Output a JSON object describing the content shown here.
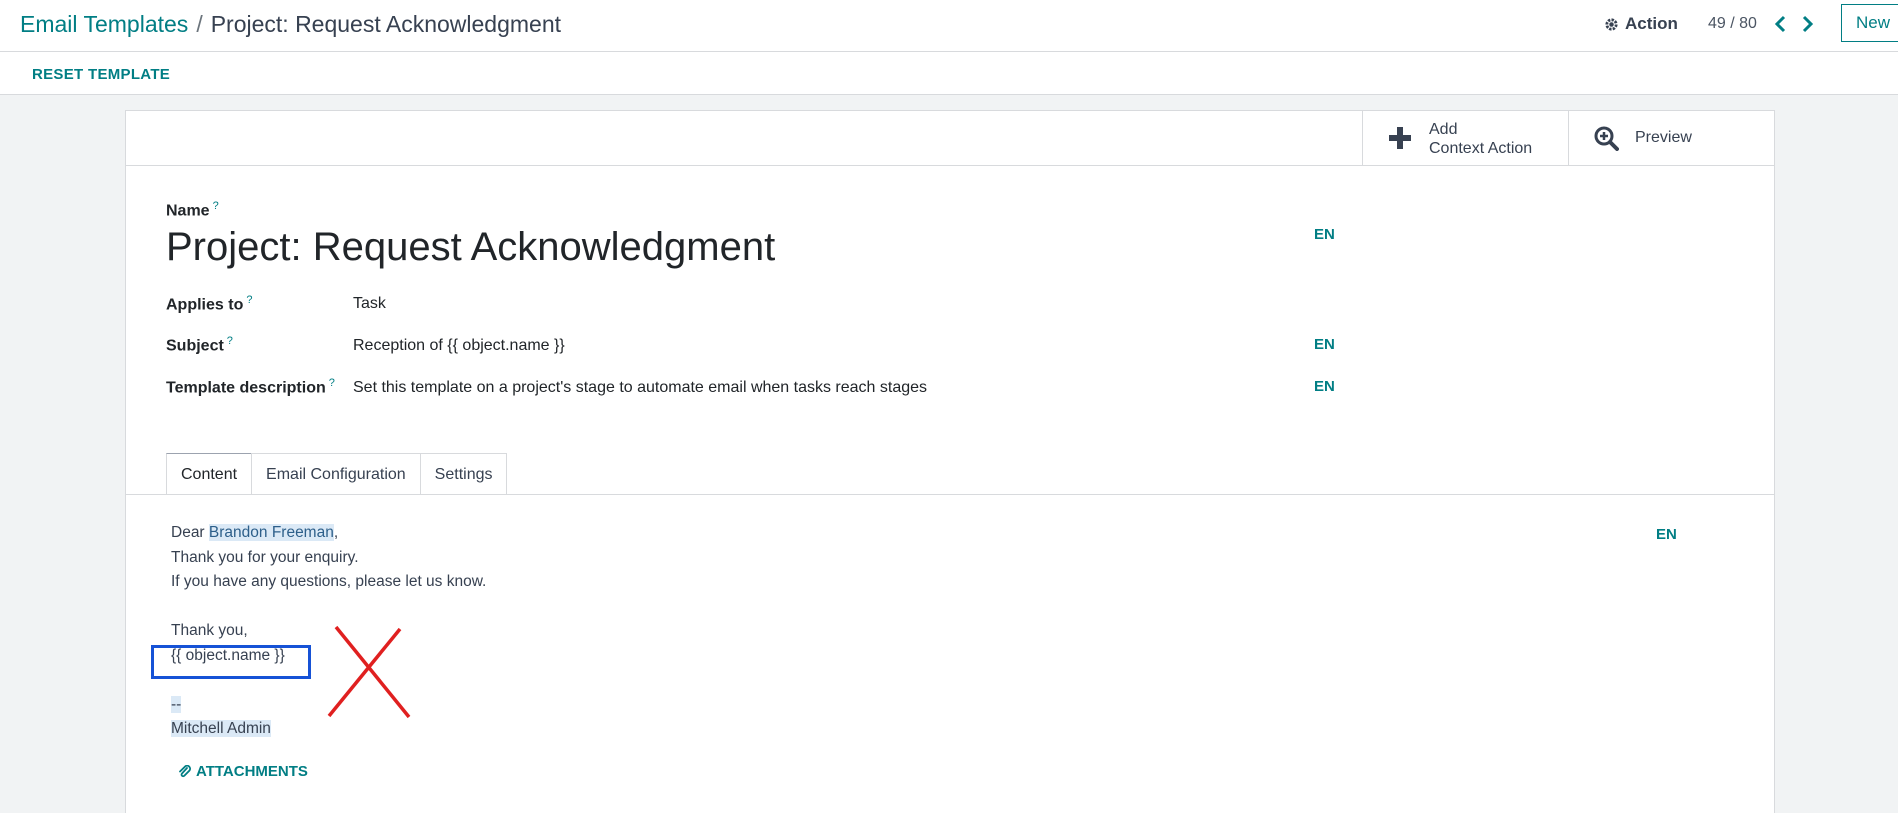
{
  "header": {
    "breadcrumb_parent": "Email Templates",
    "breadcrumb_separator": "/",
    "breadcrumb_current": "Project: Request Acknowledgment",
    "action_label": "Action",
    "pager": "49 / 80",
    "new_label": "New"
  },
  "subbar": {
    "reset_label": "RESET TEMPLATE"
  },
  "smart_buttons": {
    "add_line1": "Add",
    "add_line2": "Context Action",
    "preview": "Preview"
  },
  "form": {
    "name_label": "Name",
    "name_value": "Project: Request Acknowledgment",
    "applies_label": "Applies to",
    "applies_value": "Task",
    "subject_label": "Subject",
    "subject_value": "Reception of {{ object.name }}",
    "description_label": "Template description",
    "description_value": "Set this template on a project's stage to automate email when tasks reach stages",
    "help_mark": "?",
    "lang": "EN"
  },
  "tabs": {
    "content": "Content",
    "email_config": "Email Configuration",
    "settings": "Settings"
  },
  "body": {
    "dear": "Dear ",
    "recipient": "Brandon Freeman",
    "comma": ",",
    "line2": "Thank you for your enquiry.",
    "line3": "If you have any questions, please let us know.",
    "thanks": "Thank you,",
    "placeholder": "{{ object.name }}",
    "sig_sep": "--",
    "sig_name": "Mitchell Admin",
    "attachments": "ATTACHMENTS"
  },
  "colors": {
    "accent": "#017e84",
    "highlight": "#dbe9f6",
    "box": "#1652d6",
    "cross": "#e02020"
  }
}
